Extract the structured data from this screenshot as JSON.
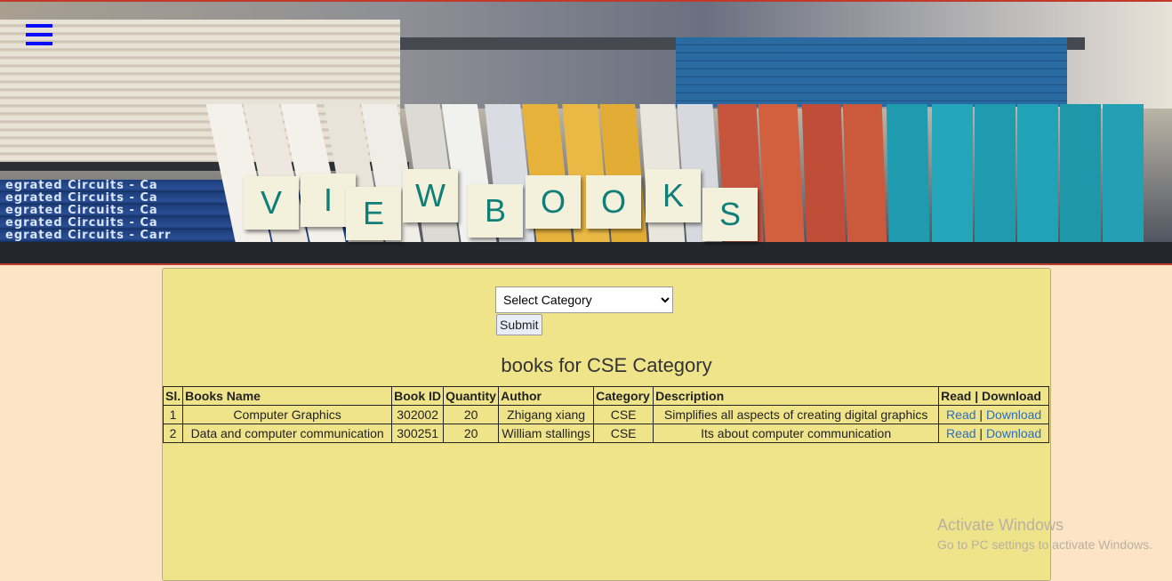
{
  "banner": {
    "tiles": [
      "V",
      "I",
      "E",
      "W",
      "B",
      "O",
      "O",
      "K",
      "S"
    ],
    "stack_left_text": [
      "egrated Circuits - Ca",
      "egrated Circuits - Ca",
      "egrated Circuits - Ca",
      "egrated Circuits - Ca",
      "egrated Circuits - Carr"
    ]
  },
  "filter": {
    "category_selected": "Select Category",
    "submit_label": "Submit"
  },
  "results": {
    "title": "books for CSE Category",
    "columns": [
      "Sl.",
      "Books Name",
      "Book ID",
      "Quantity",
      "Author",
      "Category",
      "Description",
      "Read | Download"
    ],
    "rows": [
      {
        "sl": "1",
        "name": "Computer Graphics",
        "book_id": "302002",
        "quantity": "20",
        "author": "Zhigang xiang",
        "category": "CSE",
        "description": "Simplifies all aspects of creating digital graphics",
        "read": "Read",
        "sep": "|",
        "download": "Download"
      },
      {
        "sl": "2",
        "name": "Data and computer communication",
        "book_id": "300251",
        "quantity": "20",
        "author": "William stallings",
        "category": "CSE",
        "description": "Its about computer communication",
        "read": "Read",
        "sep": "|",
        "download": "Download"
      }
    ]
  },
  "watermark": {
    "line1": "Activate Windows",
    "line2": "Go to PC settings to activate Windows."
  },
  "colors": {
    "page_bg": "#fde4c4",
    "panel_bg": "#f0e48a",
    "tile_text": "#0f7f78",
    "menu_icon": "#0a0aff",
    "link": "#2a6fc0"
  }
}
